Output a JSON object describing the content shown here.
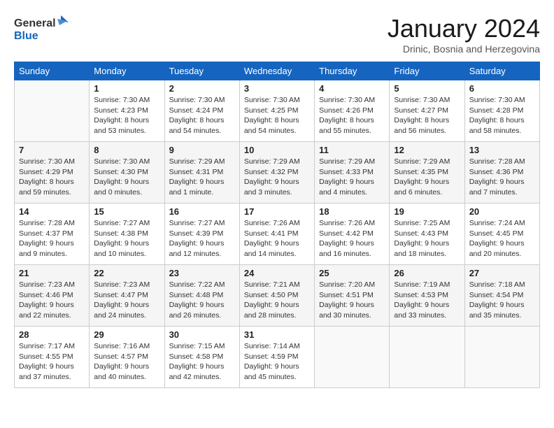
{
  "header": {
    "logo_general": "General",
    "logo_blue": "Blue",
    "month_title": "January 2024",
    "subtitle": "Drinic, Bosnia and Herzegovina"
  },
  "days_of_week": [
    "Sunday",
    "Monday",
    "Tuesday",
    "Wednesday",
    "Thursday",
    "Friday",
    "Saturday"
  ],
  "weeks": [
    [
      {
        "day": "",
        "sunrise": "",
        "sunset": "",
        "daylight": ""
      },
      {
        "day": "1",
        "sunrise": "Sunrise: 7:30 AM",
        "sunset": "Sunset: 4:23 PM",
        "daylight": "Daylight: 8 hours and 53 minutes."
      },
      {
        "day": "2",
        "sunrise": "Sunrise: 7:30 AM",
        "sunset": "Sunset: 4:24 PM",
        "daylight": "Daylight: 8 hours and 54 minutes."
      },
      {
        "day": "3",
        "sunrise": "Sunrise: 7:30 AM",
        "sunset": "Sunset: 4:25 PM",
        "daylight": "Daylight: 8 hours and 54 minutes."
      },
      {
        "day": "4",
        "sunrise": "Sunrise: 7:30 AM",
        "sunset": "Sunset: 4:26 PM",
        "daylight": "Daylight: 8 hours and 55 minutes."
      },
      {
        "day": "5",
        "sunrise": "Sunrise: 7:30 AM",
        "sunset": "Sunset: 4:27 PM",
        "daylight": "Daylight: 8 hours and 56 minutes."
      },
      {
        "day": "6",
        "sunrise": "Sunrise: 7:30 AM",
        "sunset": "Sunset: 4:28 PM",
        "daylight": "Daylight: 8 hours and 58 minutes."
      }
    ],
    [
      {
        "day": "7",
        "sunrise": "Sunrise: 7:30 AM",
        "sunset": "Sunset: 4:29 PM",
        "daylight": "Daylight: 8 hours and 59 minutes."
      },
      {
        "day": "8",
        "sunrise": "Sunrise: 7:30 AM",
        "sunset": "Sunset: 4:30 PM",
        "daylight": "Daylight: 9 hours and 0 minutes."
      },
      {
        "day": "9",
        "sunrise": "Sunrise: 7:29 AM",
        "sunset": "Sunset: 4:31 PM",
        "daylight": "Daylight: 9 hours and 1 minute."
      },
      {
        "day": "10",
        "sunrise": "Sunrise: 7:29 AM",
        "sunset": "Sunset: 4:32 PM",
        "daylight": "Daylight: 9 hours and 3 minutes."
      },
      {
        "day": "11",
        "sunrise": "Sunrise: 7:29 AM",
        "sunset": "Sunset: 4:33 PM",
        "daylight": "Daylight: 9 hours and 4 minutes."
      },
      {
        "day": "12",
        "sunrise": "Sunrise: 7:29 AM",
        "sunset": "Sunset: 4:35 PM",
        "daylight": "Daylight: 9 hours and 6 minutes."
      },
      {
        "day": "13",
        "sunrise": "Sunrise: 7:28 AM",
        "sunset": "Sunset: 4:36 PM",
        "daylight": "Daylight: 9 hours and 7 minutes."
      }
    ],
    [
      {
        "day": "14",
        "sunrise": "Sunrise: 7:28 AM",
        "sunset": "Sunset: 4:37 PM",
        "daylight": "Daylight: 9 hours and 9 minutes."
      },
      {
        "day": "15",
        "sunrise": "Sunrise: 7:27 AM",
        "sunset": "Sunset: 4:38 PM",
        "daylight": "Daylight: 9 hours and 10 minutes."
      },
      {
        "day": "16",
        "sunrise": "Sunrise: 7:27 AM",
        "sunset": "Sunset: 4:39 PM",
        "daylight": "Daylight: 9 hours and 12 minutes."
      },
      {
        "day": "17",
        "sunrise": "Sunrise: 7:26 AM",
        "sunset": "Sunset: 4:41 PM",
        "daylight": "Daylight: 9 hours and 14 minutes."
      },
      {
        "day": "18",
        "sunrise": "Sunrise: 7:26 AM",
        "sunset": "Sunset: 4:42 PM",
        "daylight": "Daylight: 9 hours and 16 minutes."
      },
      {
        "day": "19",
        "sunrise": "Sunrise: 7:25 AM",
        "sunset": "Sunset: 4:43 PM",
        "daylight": "Daylight: 9 hours and 18 minutes."
      },
      {
        "day": "20",
        "sunrise": "Sunrise: 7:24 AM",
        "sunset": "Sunset: 4:45 PM",
        "daylight": "Daylight: 9 hours and 20 minutes."
      }
    ],
    [
      {
        "day": "21",
        "sunrise": "Sunrise: 7:23 AM",
        "sunset": "Sunset: 4:46 PM",
        "daylight": "Daylight: 9 hours and 22 minutes."
      },
      {
        "day": "22",
        "sunrise": "Sunrise: 7:23 AM",
        "sunset": "Sunset: 4:47 PM",
        "daylight": "Daylight: 9 hours and 24 minutes."
      },
      {
        "day": "23",
        "sunrise": "Sunrise: 7:22 AM",
        "sunset": "Sunset: 4:48 PM",
        "daylight": "Daylight: 9 hours and 26 minutes."
      },
      {
        "day": "24",
        "sunrise": "Sunrise: 7:21 AM",
        "sunset": "Sunset: 4:50 PM",
        "daylight": "Daylight: 9 hours and 28 minutes."
      },
      {
        "day": "25",
        "sunrise": "Sunrise: 7:20 AM",
        "sunset": "Sunset: 4:51 PM",
        "daylight": "Daylight: 9 hours and 30 minutes."
      },
      {
        "day": "26",
        "sunrise": "Sunrise: 7:19 AM",
        "sunset": "Sunset: 4:53 PM",
        "daylight": "Daylight: 9 hours and 33 minutes."
      },
      {
        "day": "27",
        "sunrise": "Sunrise: 7:18 AM",
        "sunset": "Sunset: 4:54 PM",
        "daylight": "Daylight: 9 hours and 35 minutes."
      }
    ],
    [
      {
        "day": "28",
        "sunrise": "Sunrise: 7:17 AM",
        "sunset": "Sunset: 4:55 PM",
        "daylight": "Daylight: 9 hours and 37 minutes."
      },
      {
        "day": "29",
        "sunrise": "Sunrise: 7:16 AM",
        "sunset": "Sunset: 4:57 PM",
        "daylight": "Daylight: 9 hours and 40 minutes."
      },
      {
        "day": "30",
        "sunrise": "Sunrise: 7:15 AM",
        "sunset": "Sunset: 4:58 PM",
        "daylight": "Daylight: 9 hours and 42 minutes."
      },
      {
        "day": "31",
        "sunrise": "Sunrise: 7:14 AM",
        "sunset": "Sunset: 4:59 PM",
        "daylight": "Daylight: 9 hours and 45 minutes."
      },
      {
        "day": "",
        "sunrise": "",
        "sunset": "",
        "daylight": ""
      },
      {
        "day": "",
        "sunrise": "",
        "sunset": "",
        "daylight": ""
      },
      {
        "day": "",
        "sunrise": "",
        "sunset": "",
        "daylight": ""
      }
    ]
  ]
}
